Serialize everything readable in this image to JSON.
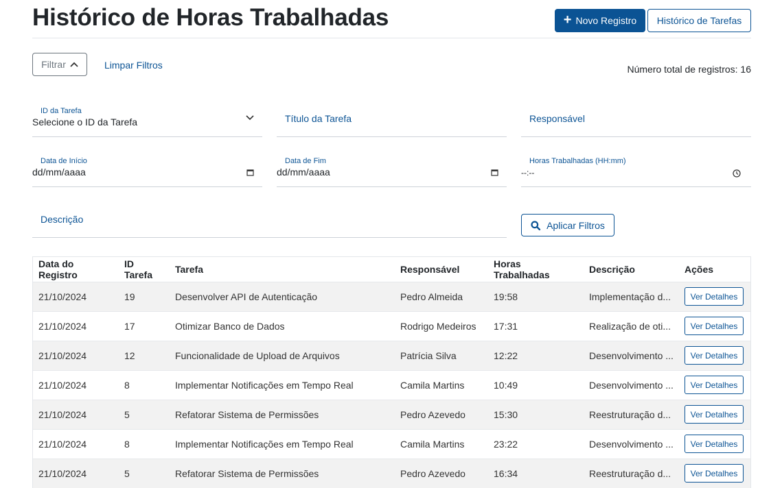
{
  "header": {
    "title": "Histórico de Horas Trabalhadas",
    "new_record_label": "Novo Registro",
    "task_history_label": "Histórico de Tarefas"
  },
  "filters": {
    "toggle_label": "Filtrar",
    "clear_label": "Limpar Filtros",
    "total_label": "Número total de registros: 16",
    "task_id": {
      "label": "ID da Tarefa",
      "value": "Selecione o ID da Tarefa"
    },
    "task_title": {
      "placeholder": "Título da Tarefa"
    },
    "responsible": {
      "placeholder": "Responsável"
    },
    "start_date": {
      "label": "Data de Início",
      "value": "dd/mm/aaaa"
    },
    "end_date": {
      "label": "Data de Fim",
      "value": "dd/mm/aaaa"
    },
    "hours": {
      "label": "Horas Trabalhadas (HH:mm)",
      "value": "--:--"
    },
    "description": {
      "placeholder": "Descrição"
    },
    "apply_label": "Aplicar Filtros"
  },
  "table": {
    "columns": [
      "Data do Registro",
      "ID Tarefa",
      "Tarefa",
      "Responsável",
      "Horas Trabalhadas",
      "Descrição",
      "Ações"
    ],
    "action_label": "Ver Detalhes",
    "rows": [
      {
        "date": "21/10/2024",
        "id": "19",
        "task": "Desenvolver API de Autenticação",
        "responsible": "Pedro Almeida",
        "hours": "19:58",
        "description": "Implementação d..."
      },
      {
        "date": "21/10/2024",
        "id": "17",
        "task": "Otimizar Banco de Dados",
        "responsible": "Rodrigo Medeiros",
        "hours": "17:31",
        "description": "Realização de oti..."
      },
      {
        "date": "21/10/2024",
        "id": "12",
        "task": "Funcionalidade de Upload de Arquivos",
        "responsible": "Patrícia Silva",
        "hours": "12:22",
        "description": "Desenvolvimento ..."
      },
      {
        "date": "21/10/2024",
        "id": "8",
        "task": "Implementar Notificações em Tempo Real",
        "responsible": "Camila Martins",
        "hours": "10:49",
        "description": "Desenvolvimento ..."
      },
      {
        "date": "21/10/2024",
        "id": "5",
        "task": "Refatorar Sistema de Permissões",
        "responsible": "Pedro Azevedo",
        "hours": "15:30",
        "description": "Reestruturação d..."
      },
      {
        "date": "21/10/2024",
        "id": "8",
        "task": "Implementar Notificações em Tempo Real",
        "responsible": "Camila Martins",
        "hours": "23:22",
        "description": "Desenvolvimento ..."
      },
      {
        "date": "21/10/2024",
        "id": "5",
        "task": "Refatorar Sistema de Permissões",
        "responsible": "Pedro Azevedo",
        "hours": "16:34",
        "description": "Reestruturação d..."
      }
    ]
  },
  "colors": {
    "primary": "#0b5394",
    "row_stripe": "#f2f2f2"
  },
  "icons": [
    "plus-icon",
    "chevron-up-icon",
    "chevron-down-icon",
    "calendar-icon",
    "clock-icon",
    "search-icon"
  ]
}
